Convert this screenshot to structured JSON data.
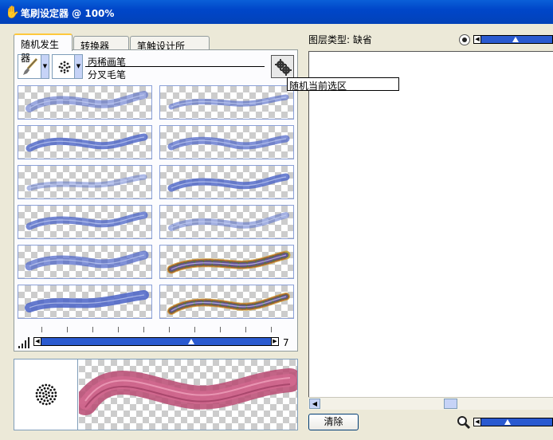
{
  "window": {
    "title": "笔刷设定器 @ 100%"
  },
  "tabs": [
    {
      "label": "随机发生器"
    },
    {
      "label": "转换器"
    },
    {
      "label": "笔触设计所"
    }
  ],
  "brush": {
    "name_line1": "丙稀画笔",
    "name_line2": "分叉毛笔"
  },
  "tooltip": {
    "text": "随机当前选区"
  },
  "variation_slider": {
    "value_label": "7",
    "position": 0.66
  },
  "layer": {
    "label": "图层类型: 缺省"
  },
  "opacity_slider": {
    "position": 0.55
  },
  "zoom_slider": {
    "position": 0.42
  },
  "canvas_scrollbar": {
    "position": 0.55
  },
  "clear_button": {
    "label": "清除"
  },
  "colors": {
    "stroke_blue": "#4A63C7",
    "stroke_pink": "#C8527A",
    "accent_tab": "#FFC83C",
    "title_bar": "#0046C9"
  },
  "icons": {
    "title": "brush-hand-icon",
    "tool": "paintbrush-icon",
    "dab": "dab-dots-icon",
    "gear": "gear-randomize-icon",
    "size": "size-bars-icon",
    "opacity": "dot-icon",
    "zoom": "magnifier-icon"
  }
}
